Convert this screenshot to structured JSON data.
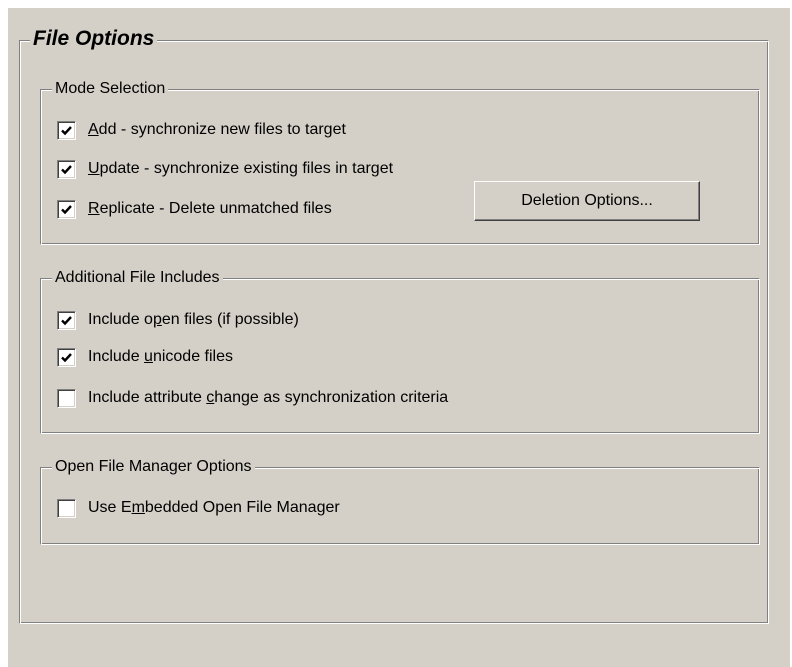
{
  "outer_group": {
    "title": "File Options"
  },
  "mode_selection": {
    "title": "Mode Selection",
    "items": [
      {
        "label_mnemonic": "A",
        "label_rest": "dd - synchronize new files to target",
        "checked": true
      },
      {
        "label_mnemonic": "U",
        "label_rest": "pdate - synchronize existing files in target",
        "checked": true
      },
      {
        "label_mnemonic": "R",
        "label_rest": "eplicate - Delete unmatched files",
        "checked": true
      }
    ],
    "deletion_button_label": "Deletion Options..."
  },
  "additional_includes": {
    "title": "Additional File Includes",
    "items": [
      {
        "label_pre": "Include o",
        "label_mnemonic": "p",
        "label_post": "en files (if possible)",
        "checked": true
      },
      {
        "label_pre": "Include ",
        "label_mnemonic": "u",
        "label_post": "nicode files",
        "checked": true
      },
      {
        "label_pre": "Include attribute ",
        "label_mnemonic": "c",
        "label_post": "hange as synchronization criteria",
        "checked": false
      }
    ]
  },
  "open_file_manager": {
    "title": "Open File Manager Options",
    "items": [
      {
        "label_pre": "Use E",
        "label_mnemonic": "m",
        "label_post": "bedded Open File Manager",
        "checked": false
      }
    ]
  },
  "colors": {
    "face": "#d4d0c8",
    "shadow": "#808080",
    "highlight": "#ffffff",
    "check_mark": "#000000"
  }
}
